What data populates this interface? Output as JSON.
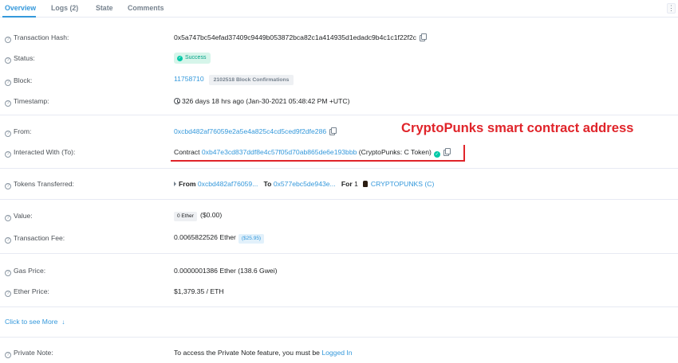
{
  "tabs": [
    {
      "label": "Overview",
      "active": true
    },
    {
      "label": "Logs (2)",
      "active": false
    },
    {
      "label": "State",
      "active": false
    },
    {
      "label": "Comments",
      "active": false
    }
  ],
  "menu_icon": "kebab-menu-icon",
  "fields": {
    "tx_hash": {
      "label": "Transaction Hash:",
      "value": "0x5a747bc54efad37409c9449b053872bca82c1a414935d1edadc9b4c1c1f22f2c"
    },
    "status": {
      "label": "Status:",
      "value": "Success"
    },
    "block": {
      "label": "Block:",
      "number": "11758710",
      "confirmations": "2102518 Block Confirmations"
    },
    "timestamp": {
      "label": "Timestamp:",
      "value": "326 days 18 hrs ago (Jan-30-2021 05:48:42 PM +UTC)"
    },
    "from": {
      "label": "From:",
      "address": "0xcbd482af76059e2a5e4a825c4cd5ced9f2dfe286"
    },
    "to": {
      "label": "Interacted With (To):",
      "prefix": "Contract",
      "address": "0xb47e3cd837ddf8e4c57f05d70ab865de6e193bbb",
      "name": "(CryptoPunks: C Token)"
    },
    "tokens": {
      "label": "Tokens Transferred:",
      "from_label": "From",
      "from_addr": "0xcbd482af76059...",
      "to_label": "To",
      "to_addr": "0x577ebc5de943e...",
      "for_label": "For",
      "amount": "1",
      "token": "CRYPTOPUNKS (C)"
    },
    "value": {
      "label": "Value:",
      "amount": "0 Ether",
      "usd": "($0.00)"
    },
    "fee": {
      "label": "Transaction Fee:",
      "amount": "0.0065822526 Ether",
      "usd": "($25.95)"
    },
    "gas_price": {
      "label": "Gas Price:",
      "value": "0.0000001386 Ether (138.6 Gwei)"
    },
    "ether_price": {
      "label": "Ether Price:",
      "value": "$1,379.35 / ETH"
    },
    "private_note": {
      "label": "Private Note:",
      "text": "To access the Private Note feature, you must be",
      "link": "Logged In"
    }
  },
  "help_glyph": "?",
  "more_link": "Click to see More",
  "more_arrow": "↓",
  "annotation": "CryptoPunks smart contract address",
  "colors": {
    "accent": "#3498db",
    "success": "#00c9a7",
    "annotation": "#e0242a"
  }
}
